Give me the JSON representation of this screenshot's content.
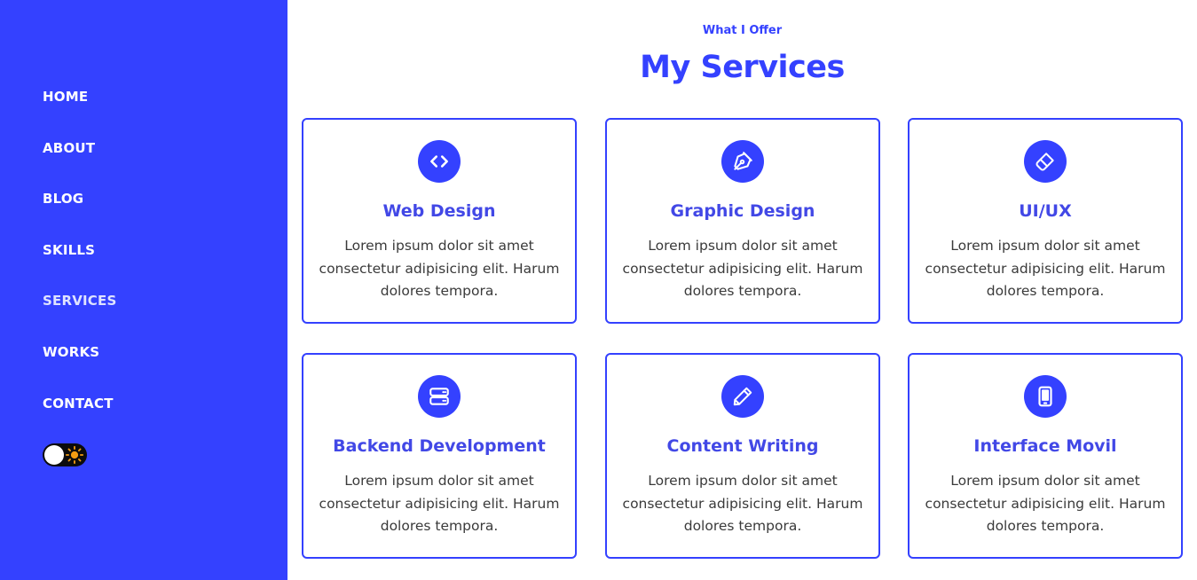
{
  "colors": {
    "accent": "#3441ff",
    "title": "#4248e6",
    "text": "#3a3a3a"
  },
  "nav": [
    {
      "label": "HOME"
    },
    {
      "label": "ABOUT"
    },
    {
      "label": "BLOG"
    },
    {
      "label": "SKILLS"
    },
    {
      "label": "SERVICES",
      "active": true
    },
    {
      "label": "WORKS"
    },
    {
      "label": "CONTACT"
    }
  ],
  "theme_toggle": {
    "state": "light",
    "icon": "sun-icon"
  },
  "section": {
    "eyebrow": "What I Offer",
    "title": "My Services"
  },
  "services": [
    {
      "icon": "code-icon",
      "title": "Web Design",
      "description": "Lorem ipsum dolor sit amet consectetur adipisicing elit. Harum dolores tempora."
    },
    {
      "icon": "pen-nib-icon",
      "title": "Graphic Design",
      "description": "Lorem ipsum dolor sit amet consectetur adipisicing elit. Harum dolores tempora."
    },
    {
      "icon": "paint-brush-icon",
      "title": "UI/UX",
      "description": "Lorem ipsum dolor sit amet consectetur adipisicing elit. Harum dolores tempora."
    },
    {
      "icon": "server-icon",
      "title": "Backend Development",
      "description": "Lorem ipsum dolor sit amet consectetur adipisicing elit. Harum dolores tempora."
    },
    {
      "icon": "pencil-icon",
      "title": "Content Writing",
      "description": "Lorem ipsum dolor sit amet consectetur adipisicing elit. Harum dolores tempora."
    },
    {
      "icon": "mobile-icon",
      "title": "Interface Movil",
      "description": "Lorem ipsum dolor sit amet consectetur adipisicing elit. Harum dolores tempora."
    }
  ]
}
